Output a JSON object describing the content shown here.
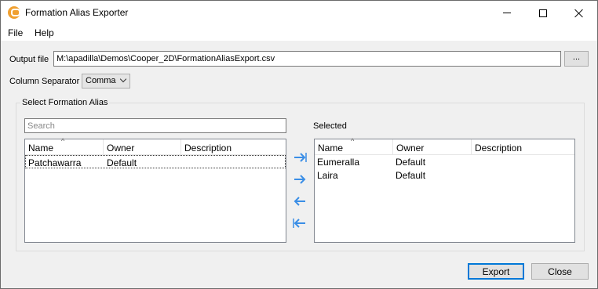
{
  "window": {
    "title": "Formation Alias Exporter",
    "icon": "app-logo-icon",
    "controls": [
      "minimize-icon",
      "maximize-icon",
      "close-icon"
    ]
  },
  "menu": {
    "file": "File",
    "help": "Help"
  },
  "output": {
    "label": "Output file",
    "value": "M:\\apadilla\\Demos\\Cooper_2D\\FormationAliasExport.csv",
    "browse_label": "..."
  },
  "separator": {
    "label": "Column Separator",
    "value": "Comma"
  },
  "group": {
    "label": "Select Formation Alias",
    "search_placeholder": "Search",
    "selected_label": "Selected"
  },
  "columns": {
    "name": "Name",
    "owner": "Owner",
    "description": "Description"
  },
  "available": [
    {
      "name": "Patchawarra",
      "owner": "Default",
      "description": ""
    }
  ],
  "selected": [
    {
      "name": "Eumeralla",
      "owner": "Default",
      "description": ""
    },
    {
      "name": "Laira",
      "owner": "Default",
      "description": ""
    }
  ],
  "transfer_buttons": [
    "move-right-icon",
    "move-all-right-icon",
    "move-left-icon",
    "move-all-left-icon"
  ],
  "buttons": {
    "export": "Export",
    "close": "Close"
  },
  "colors": {
    "accent": "#0078d7",
    "arrow": "#3a8ee6"
  }
}
